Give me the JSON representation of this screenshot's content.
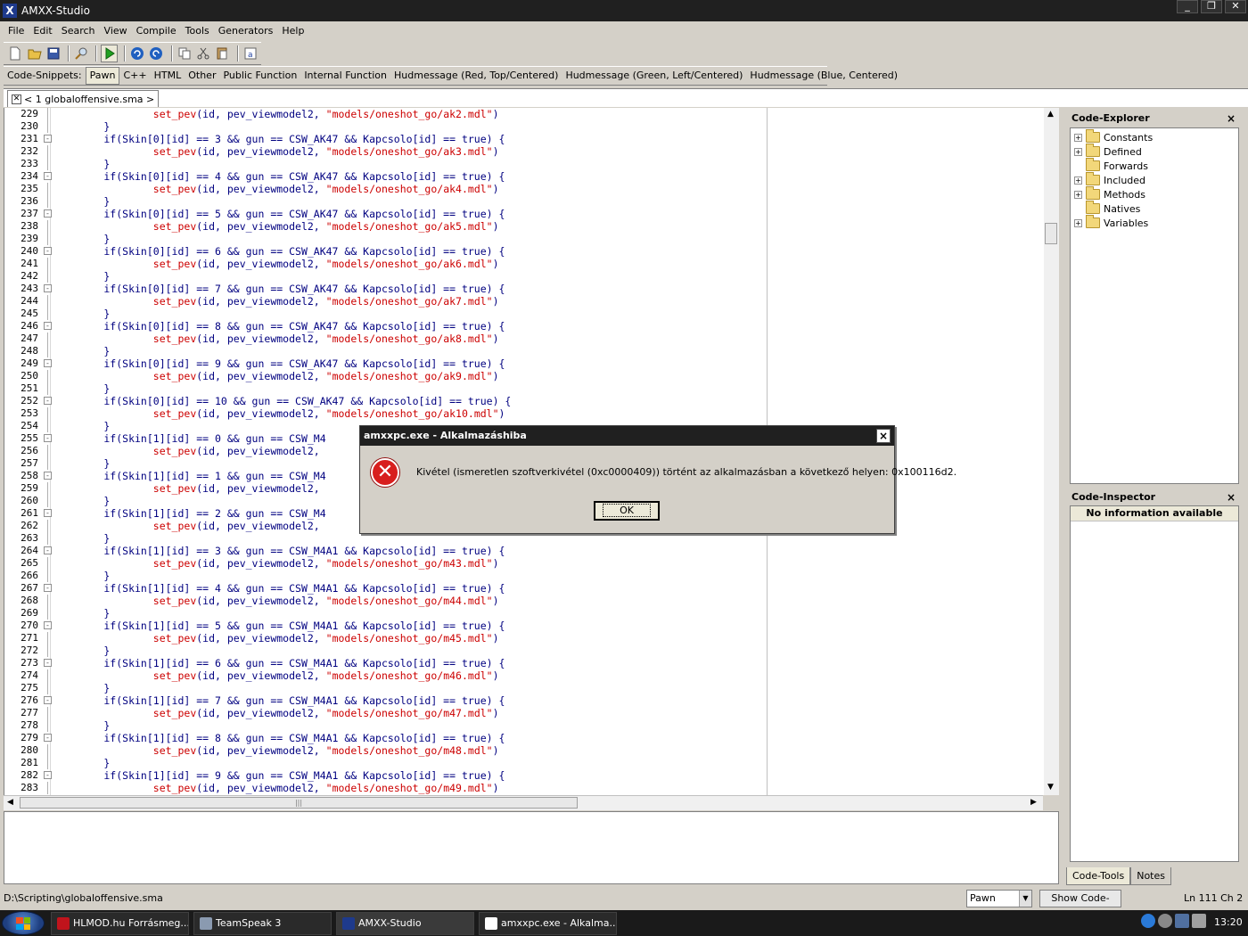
{
  "window": {
    "title": "AMXX-Studio"
  },
  "menu": [
    "File",
    "Edit",
    "Search",
    "View",
    "Compile",
    "Tools",
    "Generators",
    "Help"
  ],
  "toolbar_icons": [
    "new-file-icon",
    "open-icon",
    "save-icon",
    "find-icon",
    "compile-run-icon",
    "undo-icon",
    "redo-icon",
    "copy-icon",
    "cut-icon",
    "paste-icon",
    "select-all-icon"
  ],
  "snippets": {
    "label": "Code-Snippets:",
    "items": [
      "Pawn",
      "C++",
      "HTML",
      "Other",
      "Public Function",
      "Internal Function",
      "Hudmessage (Red, Top/Centered)",
      "Hudmessage (Green, Left/Centered)",
      "Hudmessage (Blue, Centered)"
    ],
    "active": "Pawn"
  },
  "doc_tab": {
    "label": "< 1 globaloffensive.sma >"
  },
  "editor": {
    "lines": [
      {
        "n": "229",
        "fold": "",
        "pre": "                ",
        "fn": "set_pev",
        "mid": "(id, pev_viewmodel2, ",
        "str": "\"models/oneshot_go/ak2.mdl\"",
        "post": ")"
      },
      {
        "n": "230",
        "fold": "",
        "pre": "        }",
        "fn": "",
        "mid": "",
        "str": "",
        "post": ""
      },
      {
        "n": "231",
        "fold": "-",
        "pre": "        if(Skin[0][id] == 3 && gun == CSW_AK47 && Kapcsolo[id] == true) {",
        "fn": "",
        "mid": "",
        "str": "",
        "post": ""
      },
      {
        "n": "232",
        "fold": "",
        "pre": "                ",
        "fn": "set_pev",
        "mid": "(id, pev_viewmodel2, ",
        "str": "\"models/oneshot_go/ak3.mdl\"",
        "post": ")"
      },
      {
        "n": "233",
        "fold": "",
        "pre": "        }",
        "fn": "",
        "mid": "",
        "str": "",
        "post": ""
      },
      {
        "n": "234",
        "fold": "-",
        "pre": "        if(Skin[0][id] == 4 && gun == CSW_AK47 && Kapcsolo[id] == true) {",
        "fn": "",
        "mid": "",
        "str": "",
        "post": ""
      },
      {
        "n": "235",
        "fold": "",
        "pre": "                ",
        "fn": "set_pev",
        "mid": "(id, pev_viewmodel2, ",
        "str": "\"models/oneshot_go/ak4.mdl\"",
        "post": ")"
      },
      {
        "n": "236",
        "fold": "",
        "pre": "        }",
        "fn": "",
        "mid": "",
        "str": "",
        "post": ""
      },
      {
        "n": "237",
        "fold": "-",
        "pre": "        if(Skin[0][id] == 5 && gun == CSW_AK47 && Kapcsolo[id] == true) {",
        "fn": "",
        "mid": "",
        "str": "",
        "post": ""
      },
      {
        "n": "238",
        "fold": "",
        "pre": "                ",
        "fn": "set_pev",
        "mid": "(id, pev_viewmodel2, ",
        "str": "\"models/oneshot_go/ak5.mdl\"",
        "post": ")"
      },
      {
        "n": "239",
        "fold": "",
        "pre": "        }",
        "fn": "",
        "mid": "",
        "str": "",
        "post": ""
      },
      {
        "n": "240",
        "fold": "-",
        "pre": "        if(Skin[0][id] == 6 && gun == CSW_AK47 && Kapcsolo[id] == true) {",
        "fn": "",
        "mid": "",
        "str": "",
        "post": ""
      },
      {
        "n": "241",
        "fold": "",
        "pre": "                ",
        "fn": "set_pev",
        "mid": "(id, pev_viewmodel2, ",
        "str": "\"models/oneshot_go/ak6.mdl\"",
        "post": ")"
      },
      {
        "n": "242",
        "fold": "",
        "pre": "        }",
        "fn": "",
        "mid": "",
        "str": "",
        "post": ""
      },
      {
        "n": "243",
        "fold": "-",
        "pre": "        if(Skin[0][id] == 7 && gun == CSW_AK47 && Kapcsolo[id] == true) {",
        "fn": "",
        "mid": "",
        "str": "",
        "post": ""
      },
      {
        "n": "244",
        "fold": "",
        "pre": "                ",
        "fn": "set_pev",
        "mid": "(id, pev_viewmodel2, ",
        "str": "\"models/oneshot_go/ak7.mdl\"",
        "post": ")"
      },
      {
        "n": "245",
        "fold": "",
        "pre": "        }",
        "fn": "",
        "mid": "",
        "str": "",
        "post": ""
      },
      {
        "n": "246",
        "fold": "-",
        "pre": "        if(Skin[0][id] == 8 && gun == CSW_AK47 && Kapcsolo[id] == true) {",
        "fn": "",
        "mid": "",
        "str": "",
        "post": ""
      },
      {
        "n": "247",
        "fold": "",
        "pre": "                ",
        "fn": "set_pev",
        "mid": "(id, pev_viewmodel2, ",
        "str": "\"models/oneshot_go/ak8.mdl\"",
        "post": ")"
      },
      {
        "n": "248",
        "fold": "",
        "pre": "        }",
        "fn": "",
        "mid": "",
        "str": "",
        "post": ""
      },
      {
        "n": "249",
        "fold": "-",
        "pre": "        if(Skin[0][id] == 9 && gun == CSW_AK47 && Kapcsolo[id] == true) {",
        "fn": "",
        "mid": "",
        "str": "",
        "post": ""
      },
      {
        "n": "250",
        "fold": "",
        "pre": "                ",
        "fn": "set_pev",
        "mid": "(id, pev_viewmodel2, ",
        "str": "\"models/oneshot_go/ak9.mdl\"",
        "post": ")"
      },
      {
        "n": "251",
        "fold": "",
        "pre": "        }",
        "fn": "",
        "mid": "",
        "str": "",
        "post": ""
      },
      {
        "n": "252",
        "fold": "-",
        "pre": "        if(Skin[0][id] == 10 && gun == CSW_AK47 && Kapcsolo[id] == true) {",
        "fn": "",
        "mid": "",
        "str": "",
        "post": ""
      },
      {
        "n": "253",
        "fold": "",
        "pre": "                ",
        "fn": "set_pev",
        "mid": "(id, pev_viewmodel2, ",
        "str": "\"models/oneshot_go/ak10.mdl\"",
        "post": ")"
      },
      {
        "n": "254",
        "fold": "",
        "pre": "        }",
        "fn": "",
        "mid": "",
        "str": "",
        "post": ""
      },
      {
        "n": "255",
        "fold": "-",
        "pre": "        if(Skin[1][id] == 0 && gun == CSW_M4",
        "fn": "",
        "mid": "",
        "str": "",
        "post": ""
      },
      {
        "n": "256",
        "fold": "",
        "pre": "                ",
        "fn": "set_pev",
        "mid": "(id, pev_viewmodel2,",
        "str": "",
        "post": ""
      },
      {
        "n": "257",
        "fold": "",
        "pre": "        }",
        "fn": "",
        "mid": "",
        "str": "",
        "post": ""
      },
      {
        "n": "258",
        "fold": "-",
        "pre": "        if(Skin[1][id] == 1 && gun == CSW_M4",
        "fn": "",
        "mid": "",
        "str": "",
        "post": ""
      },
      {
        "n": "259",
        "fold": "",
        "pre": "                ",
        "fn": "set_pev",
        "mid": "(id, pev_viewmodel2,",
        "str": "",
        "post": ""
      },
      {
        "n": "260",
        "fold": "",
        "pre": "        }",
        "fn": "",
        "mid": "",
        "str": "",
        "post": ""
      },
      {
        "n": "261",
        "fold": "-",
        "pre": "        if(Skin[1][id] == 2 && gun == CSW_M4",
        "fn": "",
        "mid": "",
        "str": "",
        "post": ""
      },
      {
        "n": "262",
        "fold": "",
        "pre": "                ",
        "fn": "set_pev",
        "mid": "(id, pev_viewmodel2,",
        "str": "",
        "post": ""
      },
      {
        "n": "263",
        "fold": "",
        "pre": "        }",
        "fn": "",
        "mid": "",
        "str": "",
        "post": ""
      },
      {
        "n": "264",
        "fold": "-",
        "pre": "        if(Skin[1][id] == 3 && gun == CSW_M4A1 && Kapcsolo[id] == true) {",
        "fn": "",
        "mid": "",
        "str": "",
        "post": ""
      },
      {
        "n": "265",
        "fold": "",
        "pre": "                ",
        "fn": "set_pev",
        "mid": "(id, pev_viewmodel2, ",
        "str": "\"models/oneshot_go/m43.mdl\"",
        "post": ")"
      },
      {
        "n": "266",
        "fold": "",
        "pre": "        }",
        "fn": "",
        "mid": "",
        "str": "",
        "post": ""
      },
      {
        "n": "267",
        "fold": "-",
        "pre": "        if(Skin[1][id] == 4 && gun == CSW_M4A1 && Kapcsolo[id] == true) {",
        "fn": "",
        "mid": "",
        "str": "",
        "post": ""
      },
      {
        "n": "268",
        "fold": "",
        "pre": "                ",
        "fn": "set_pev",
        "mid": "(id, pev_viewmodel2, ",
        "str": "\"models/oneshot_go/m44.mdl\"",
        "post": ")"
      },
      {
        "n": "269",
        "fold": "",
        "pre": "        }",
        "fn": "",
        "mid": "",
        "str": "",
        "post": ""
      },
      {
        "n": "270",
        "fold": "-",
        "pre": "        if(Skin[1][id] == 5 && gun == CSW_M4A1 && Kapcsolo[id] == true) {",
        "fn": "",
        "mid": "",
        "str": "",
        "post": ""
      },
      {
        "n": "271",
        "fold": "",
        "pre": "                ",
        "fn": "set_pev",
        "mid": "(id, pev_viewmodel2, ",
        "str": "\"models/oneshot_go/m45.mdl\"",
        "post": ")"
      },
      {
        "n": "272",
        "fold": "",
        "pre": "        }",
        "fn": "",
        "mid": "",
        "str": "",
        "post": ""
      },
      {
        "n": "273",
        "fold": "-",
        "pre": "        if(Skin[1][id] == 6 && gun == CSW_M4A1 && Kapcsolo[id] == true) {",
        "fn": "",
        "mid": "",
        "str": "",
        "post": ""
      },
      {
        "n": "274",
        "fold": "",
        "pre": "                ",
        "fn": "set_pev",
        "mid": "(id, pev_viewmodel2, ",
        "str": "\"models/oneshot_go/m46.mdl\"",
        "post": ")"
      },
      {
        "n": "275",
        "fold": "",
        "pre": "        }",
        "fn": "",
        "mid": "",
        "str": "",
        "post": ""
      },
      {
        "n": "276",
        "fold": "-",
        "pre": "        if(Skin[1][id] == 7 && gun == CSW_M4A1 && Kapcsolo[id] == true) {",
        "fn": "",
        "mid": "",
        "str": "",
        "post": ""
      },
      {
        "n": "277",
        "fold": "",
        "pre": "                ",
        "fn": "set_pev",
        "mid": "(id, pev_viewmodel2, ",
        "str": "\"models/oneshot_go/m47.mdl\"",
        "post": ")"
      },
      {
        "n": "278",
        "fold": "",
        "pre": "        }",
        "fn": "",
        "mid": "",
        "str": "",
        "post": ""
      },
      {
        "n": "279",
        "fold": "-",
        "pre": "        if(Skin[1][id] == 8 && gun == CSW_M4A1 && Kapcsolo[id] == true) {",
        "fn": "",
        "mid": "",
        "str": "",
        "post": ""
      },
      {
        "n": "280",
        "fold": "",
        "pre": "                ",
        "fn": "set_pev",
        "mid": "(id, pev_viewmodel2, ",
        "str": "\"models/oneshot_go/m48.mdl\"",
        "post": ")"
      },
      {
        "n": "281",
        "fold": "",
        "pre": "        }",
        "fn": "",
        "mid": "",
        "str": "",
        "post": ""
      },
      {
        "n": "282",
        "fold": "-",
        "pre": "        if(Skin[1][id] == 9 && gun == CSW_M4A1 && Kapcsolo[id] == true) {",
        "fn": "",
        "mid": "",
        "str": "",
        "post": ""
      },
      {
        "n": "283",
        "fold": "",
        "pre": "                ",
        "fn": "set_pev",
        "mid": "(id, pev_viewmodel2, ",
        "str": "\"models/oneshot_go/m49.mdl\"",
        "post": ")"
      }
    ]
  },
  "code_explorer": {
    "title": "Code-Explorer",
    "close": "×",
    "items": [
      {
        "label": "Constants",
        "expandable": true
      },
      {
        "label": "Defined",
        "expandable": true
      },
      {
        "label": "Forwards",
        "expandable": false
      },
      {
        "label": "Included",
        "expandable": true
      },
      {
        "label": "Methods",
        "expandable": true
      },
      {
        "label": "Natives",
        "expandable": false
      },
      {
        "label": "Variables",
        "expandable": true
      }
    ]
  },
  "code_inspector": {
    "title": "Code-Inspector",
    "close": "×",
    "info": "No information available"
  },
  "panel_tabs": [
    "Code-Tools",
    "Notes"
  ],
  "status": {
    "path": "D:\\Scripting\\globaloffensive.sma",
    "language": "Pawn",
    "show_tools": "Show Code-Tools",
    "position": "Ln 111 Ch 2"
  },
  "dialog": {
    "title": "amxxpc.exe - Alkalmazáshiba",
    "message": "Kivétel (ismeretlen szoftverkivétel (0xc0000409)) történt az alkalmazásban a következő helyen: 0x100116d2.",
    "ok": "OK",
    "close": "×",
    "icon": "✕"
  },
  "taskbar": {
    "items": [
      {
        "label": "HLMOD.hu Forrásmeg...",
        "color": "#c0141c"
      },
      {
        "label": "TeamSpeak 3",
        "color": "#8a9ab0"
      },
      {
        "label": "AMXX-Studio",
        "color": "#1e3a8c"
      },
      {
        "label": "amxxpc.exe - Alkalma...",
        "color": "#ffffff"
      }
    ],
    "clock": "13:20"
  }
}
